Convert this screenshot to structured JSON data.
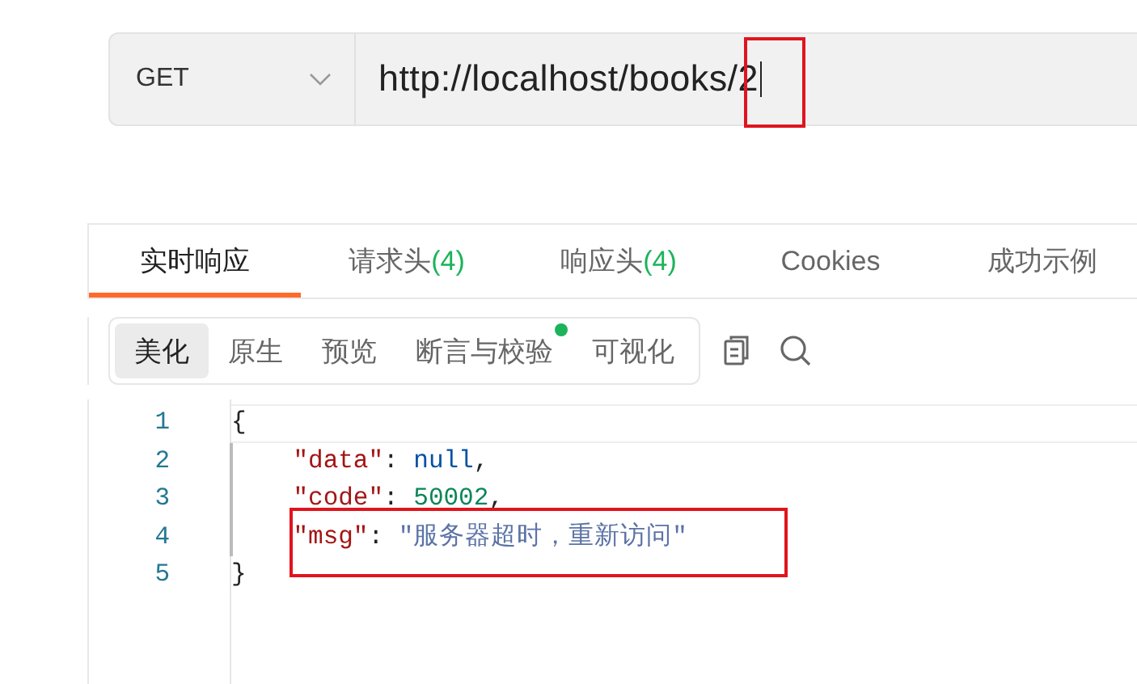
{
  "request": {
    "method": "GET",
    "url": "http://localhost/books/2"
  },
  "response_tabs": [
    {
      "label": "实时响应",
      "selected": true
    },
    {
      "label": "请求头",
      "count": "(4)",
      "selected": false
    },
    {
      "label": "响应头",
      "count": "(4)",
      "selected": false
    },
    {
      "label": "Cookies",
      "selected": false
    },
    {
      "label": "成功示例",
      "selected": false
    }
  ],
  "view_tabs": [
    {
      "label": "美化",
      "selected": true,
      "dot": false
    },
    {
      "label": "原生",
      "selected": false,
      "dot": false
    },
    {
      "label": "预览",
      "selected": false,
      "dot": false
    },
    {
      "label": "断言与校验",
      "selected": false,
      "dot": true
    },
    {
      "label": "可视化",
      "selected": false,
      "dot": false
    }
  ],
  "code": [
    {
      "number": "1",
      "tokens": [
        {
          "kind": "punct",
          "text": "{"
        }
      ]
    },
    {
      "number": "2",
      "tokens": [
        {
          "kind": "key",
          "text": "    \"data\""
        },
        {
          "kind": "punct",
          "text": ": "
        },
        {
          "kind": "null",
          "text": "null"
        },
        {
          "kind": "punct",
          "text": ","
        }
      ]
    },
    {
      "number": "3",
      "tokens": [
        {
          "kind": "key",
          "text": "    \"code\""
        },
        {
          "kind": "punct",
          "text": ": "
        },
        {
          "kind": "number",
          "text": "50002"
        },
        {
          "kind": "punct",
          "text": ","
        }
      ]
    },
    {
      "number": "4",
      "tokens": [
        {
          "kind": "key",
          "text": "    \"msg\""
        },
        {
          "kind": "punct",
          "text": ": "
        },
        {
          "kind": "string",
          "text": "\"服务器超时，重新访问\""
        }
      ]
    },
    {
      "number": "5",
      "tokens": [
        {
          "kind": "punct",
          "text": "}"
        }
      ]
    }
  ]
}
